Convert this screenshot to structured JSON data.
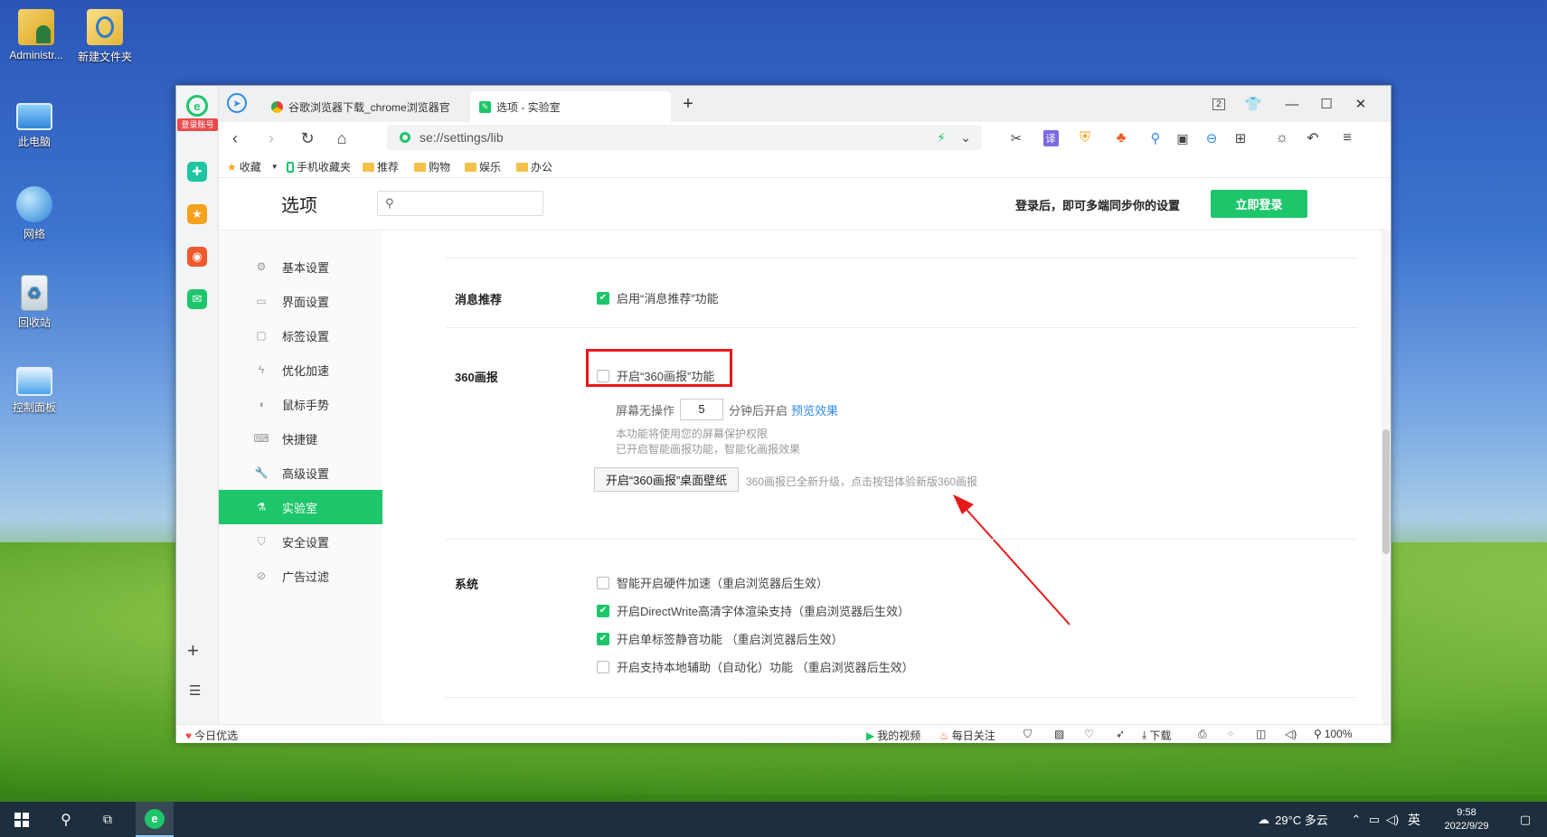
{
  "desktop": {
    "icons": [
      {
        "label": "Administr...",
        "icon": "user-folder-icon"
      },
      {
        "label": "新建文件夹",
        "icon": "folder-icon"
      },
      {
        "label": "此电脑",
        "icon": "computer-icon"
      },
      {
        "label": "网络",
        "icon": "network-icon"
      },
      {
        "label": "回收站",
        "icon": "recycle-bin-icon"
      },
      {
        "label": "控制面板",
        "icon": "control-panel-icon"
      }
    ]
  },
  "leftbar": {
    "login_label": "登录账号",
    "colors": {
      "green": "#1dc66a",
      "orange": "#f6a21c",
      "red": "#ef5a2b"
    }
  },
  "tabs": [
    {
      "title": "谷歌浏览器下载_chrome浏览器官",
      "icon": "chrome-icon"
    },
    {
      "title": "选项 - 实验室",
      "icon": "settings-icon"
    }
  ],
  "window_controls": {
    "tab_count": "2"
  },
  "address": {
    "url": "se://settings/lib"
  },
  "bookmarks": [
    {
      "label": "收藏",
      "icon": "star-icon"
    },
    {
      "label": "手机收藏夹",
      "icon": "phone-icon"
    },
    {
      "label": "推荐",
      "icon": "folder-icon"
    },
    {
      "label": "购物",
      "icon": "folder-icon"
    },
    {
      "label": "娱乐",
      "icon": "folder-icon"
    },
    {
      "label": "办公",
      "icon": "folder-icon"
    }
  ],
  "settings_header": {
    "title": "选项",
    "login_hint": "登录后，即可多端同步你的设置",
    "login_button": "立即登录",
    "accent": "#1dc66a"
  },
  "sidebar": {
    "items": [
      {
        "label": "基本设置",
        "icon": "gear-icon"
      },
      {
        "label": "界面设置",
        "icon": "window-icon"
      },
      {
        "label": "标签设置",
        "icon": "tab-icon"
      },
      {
        "label": "优化加速",
        "icon": "bolt-icon"
      },
      {
        "label": "鼠标手势",
        "icon": "mouse-icon"
      },
      {
        "label": "快捷键",
        "icon": "keyboard-icon"
      },
      {
        "label": "高级设置",
        "icon": "wrench-icon"
      },
      {
        "label": "实验室",
        "icon": "flask-icon",
        "active": true
      },
      {
        "label": "安全设置",
        "icon": "shield-icon"
      },
      {
        "label": "广告过滤",
        "icon": "block-icon"
      }
    ]
  },
  "sections": {
    "msg": {
      "title": "消息推荐",
      "option": "启用“消息推荐”功能",
      "checked": true
    },
    "huabao": {
      "title": "360画报",
      "option": "开启“360画报”功能",
      "checked": false,
      "idle_prefix": "屏幕无操作",
      "idle_value": "5",
      "idle_suffix": "分钟后开启",
      "preview_link": "预览效果",
      "note1": "本功能将使用您的屏幕保护权限",
      "note2": "已开启智能画报功能，智能化画报效果",
      "wallpaper_button": "开启“360画报”桌面壁纸",
      "wallpaper_hint": "360画报已全新升级，点击按钮体验新版360画报"
    },
    "system": {
      "title": "系统",
      "options": [
        {
          "label": "智能开启硬件加速（重启浏览器后生效）",
          "checked": false
        },
        {
          "label": "开启DirectWrite高清字体渲染支持（重启浏览器后生效）",
          "checked": true
        },
        {
          "label": "开启单标签静音功能 （重启浏览器后生效）",
          "checked": true
        },
        {
          "label": "开启支持本地辅助（自动化）功能 （重启浏览器后生效）",
          "checked": false
        }
      ]
    }
  },
  "statusbar": {
    "left": "今日优选",
    "video": "我的视频",
    "daily": "每日关注",
    "download": "下载",
    "zoom": "100%"
  },
  "taskbar": {
    "weather": "29°C 多云",
    "ime": "英",
    "time": "9:58",
    "date": "2022/9/29"
  }
}
